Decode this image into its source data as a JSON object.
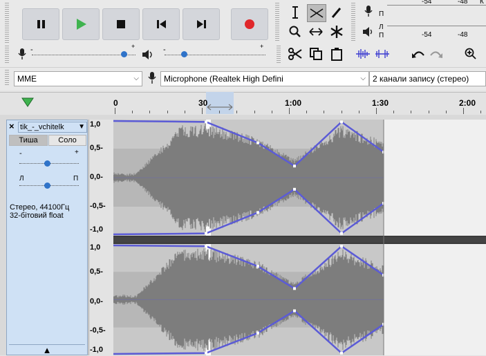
{
  "transport": {
    "pause_label": "Pause",
    "play_label": "Play",
    "stop_label": "Stop",
    "skip_start_label": "Skip to start",
    "skip_end_label": "Skip to end",
    "record_label": "Record",
    "icons": [
      "pause-icon",
      "play-icon",
      "stop-icon",
      "skip-start-icon",
      "skip-end-icon",
      "record-icon"
    ],
    "colors": {
      "play": "#3fb34f",
      "record": "#e0272b"
    }
  },
  "meters": {
    "play_channel_top": "П",
    "rec_channel_left": "Л",
    "rec_channel_right": "П",
    "scale_top": [
      "-54",
      "-48",
      "К"
    ],
    "scale_bottom": [
      "-54",
      "-48"
    ]
  },
  "mixer": {
    "mic_min": "-",
    "mic_max": "+",
    "spk_min": "-",
    "spk_max": "+"
  },
  "devices": {
    "host": "MME",
    "mic": "Microphone (Realtek High Defini",
    "channels": "2 канали запису (стерео)"
  },
  "timeline": {
    "labels": [
      "0",
      "30",
      "1:00",
      "1:30",
      "2:00"
    ]
  },
  "track": {
    "name": "tik_-_vchitelk",
    "mute": "Тиша",
    "solo": "Соло",
    "gain_min": "-",
    "gain_max": "+",
    "pan_left": "Л",
    "pan_right": "П",
    "info_line1": "Стерео, 44100Гц",
    "info_line2": "32-бітовий float",
    "close": "×",
    "menu_arrow": "▼",
    "collapse_arrow": "▲"
  },
  "yaxis": {
    "top": [
      "1,0",
      "0,5-",
      "0,0-",
      "-0,5-",
      "-1,0"
    ],
    "bottom": [
      "1,0",
      "0,5-",
      "0,0-",
      "-0,5-",
      "-1,0"
    ]
  },
  "colors": {
    "waveform": "#7d7d7d",
    "envelope": "#5b5bd6",
    "track_bg": "#c8c8c8",
    "panel_bg": "#cfe1f5"
  }
}
